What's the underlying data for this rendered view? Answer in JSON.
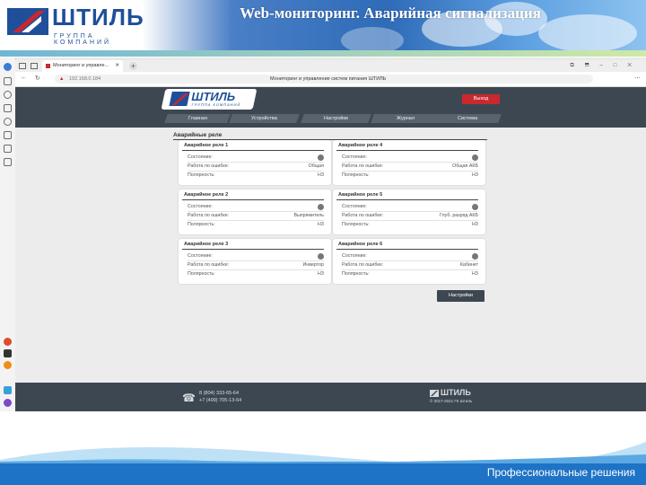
{
  "slide": {
    "title": "Web-мониторинг. Аварийная сигнализация",
    "footer_text": "Профессиональные решения",
    "logo": {
      "name": "ШТИЛЬ",
      "tagline": "ГРУППА КОМПАНИЙ"
    }
  },
  "browser": {
    "tab_title": "Мониторинг и управле...",
    "address": "192.168.0.184",
    "page_title": "Мониторинг и управление систем питания ШТИЛЬ"
  },
  "app": {
    "logo": {
      "name": "ШТИЛЬ",
      "tagline": "ГРУППА КОМПАНИЙ"
    },
    "logout_label": "Выход",
    "nav": [
      "Главная",
      "Устройства",
      "Настройки",
      "Журнал",
      "Система"
    ],
    "section_title": "Аварийные реле",
    "cards": [
      {
        "title": "Аварийное реле 1",
        "rows": [
          {
            "label": "Состояние:",
            "value": ""
          },
          {
            "label": "Работа по ошибке:",
            "value": "Общая"
          },
          {
            "label": "Полярность:",
            "value": "НЗ"
          }
        ]
      },
      {
        "title": "Аварийное реле 4",
        "rows": [
          {
            "label": "Состояние:",
            "value": ""
          },
          {
            "label": "Работа по ошибке:",
            "value": "Общая АКБ"
          },
          {
            "label": "Полярность:",
            "value": "НЗ"
          }
        ]
      },
      {
        "title": "Аварийное реле 2",
        "rows": [
          {
            "label": "Состояние:",
            "value": ""
          },
          {
            "label": "Работа по ошибке:",
            "value": "Выпрямитель"
          },
          {
            "label": "Полярность:",
            "value": "НЗ"
          }
        ]
      },
      {
        "title": "Аварийное реле 5",
        "rows": [
          {
            "label": "Состояние:",
            "value": ""
          },
          {
            "label": "Работа по ошибке:",
            "value": "Глуб. разряд АКБ"
          },
          {
            "label": "Полярность:",
            "value": "НЗ"
          }
        ]
      },
      {
        "title": "Аварийное реле 3",
        "rows": [
          {
            "label": "Состояние:",
            "value": ""
          },
          {
            "label": "Работа по ошибке:",
            "value": "Инвертор"
          },
          {
            "label": "Полярность:",
            "value": "НЗ"
          }
        ]
      },
      {
        "title": "Аварийное реле 6",
        "rows": [
          {
            "label": "Состояние:",
            "value": ""
          },
          {
            "label": "Работа по ошибке:",
            "value": "Кабинет"
          },
          {
            "label": "Полярность:",
            "value": "НЗ"
          }
        ]
      }
    ],
    "settings_button": "Настройки",
    "footer": {
      "phone1": "8 (804) 333-65-64",
      "phone2": "+7 (499) 705-13-64",
      "brand": "ШТИЛЬ",
      "copyright": "© 2017-2021 ГК Штиль"
    }
  },
  "colors": {
    "accent_red": "#c8282e",
    "dark_panel": "#3d4751",
    "brand_blue": "#1f4f9a"
  }
}
